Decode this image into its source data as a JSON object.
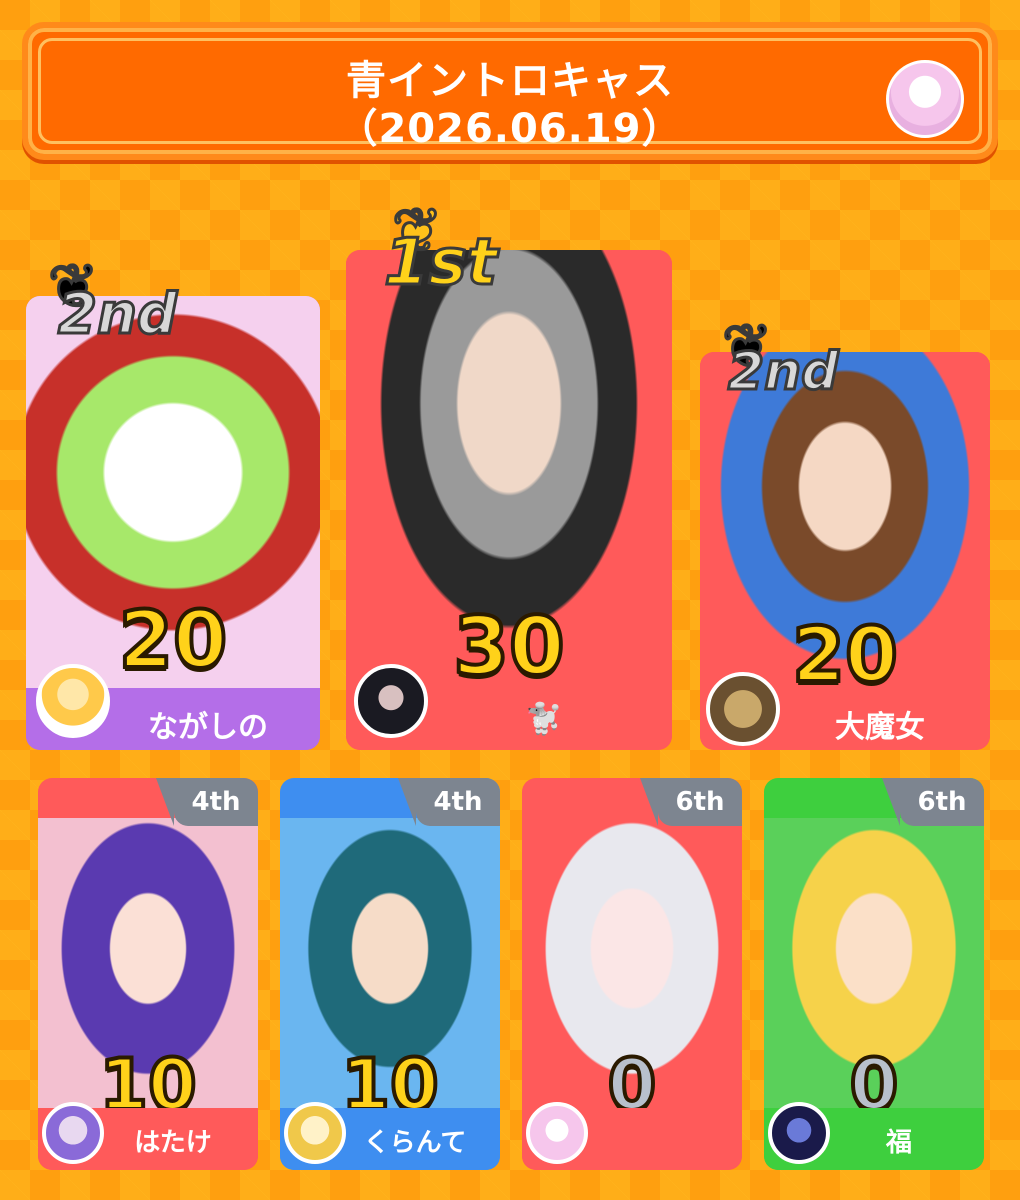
{
  "header": {
    "title": "青イントロキャス",
    "date": "（2026.06.19）"
  },
  "podium": [
    {
      "rank_label": "2nd",
      "score": "20",
      "name": "ながしの",
      "band_color": "#b46ee8",
      "art_bg": "#9be07a"
    },
    {
      "rank_label": "1st",
      "score": "30",
      "name": "🐩",
      "band_color": "#ff5a5a",
      "art_bg": "#b8b8b8"
    },
    {
      "rank_label": "2nd",
      "score": "20",
      "name": "大魔女",
      "band_color": "#ff5a5a",
      "art_bg": "#6aa8e8"
    }
  ],
  "others": [
    {
      "rank_label": "4th",
      "score": "10",
      "name": "はたけ",
      "band_color": "#ff5a5a",
      "art_bg": "#8a6ad8"
    },
    {
      "rank_label": "4th",
      "score": "10",
      "name": "くらんて",
      "band_color": "#3e8ef0",
      "art_bg": "#2f8a9a"
    },
    {
      "rank_label": "6th",
      "score": "0",
      "name": "",
      "band_color": "#ff5a5a",
      "art_bg": "#f2e6ea"
    },
    {
      "rank_label": "6th",
      "score": "0",
      "name": "福",
      "band_color": "#3ecf3e",
      "art_bg": "#ffe27a"
    }
  ],
  "colors": {
    "accent": "#ff6a00",
    "gold": "#ffd21a",
    "silver": "#c9c9c9"
  }
}
